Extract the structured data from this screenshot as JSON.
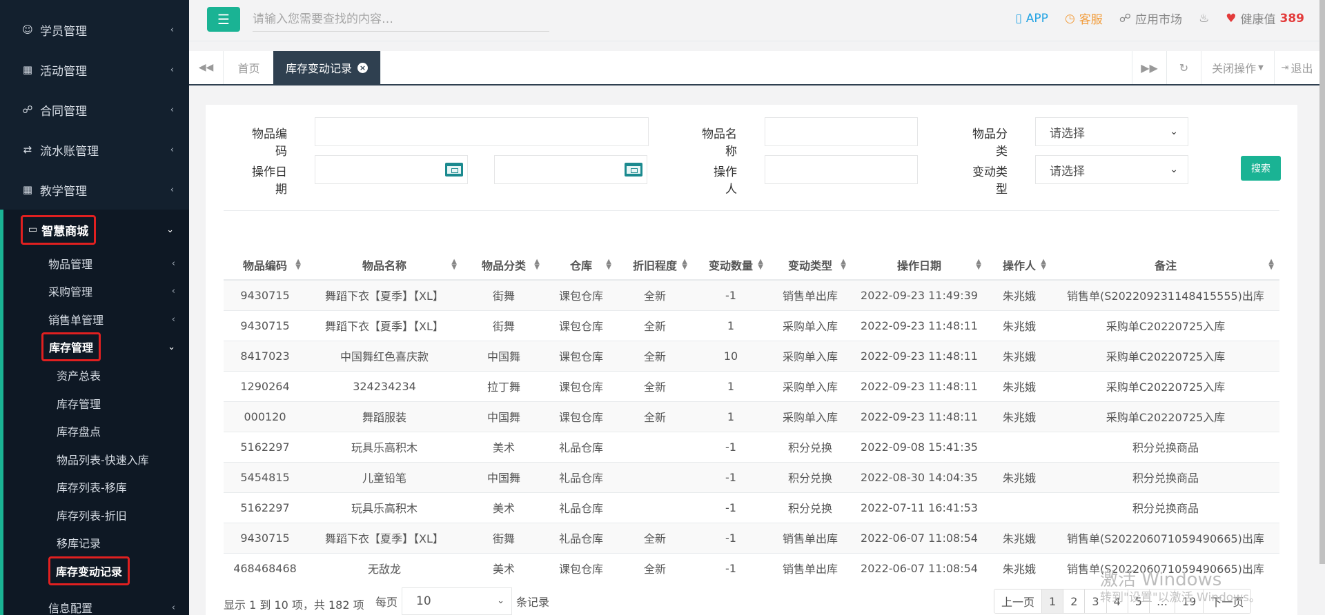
{
  "sidebar": {
    "top_items": [
      {
        "label": "学员管理",
        "icon": "users-icon"
      },
      {
        "label": "活动管理",
        "icon": "map-icon"
      },
      {
        "label": "合同管理",
        "icon": "cart-icon"
      },
      {
        "label": "流水账管理",
        "icon": "retweet-icon"
      },
      {
        "label": "教学管理",
        "icon": "calendar-icon"
      },
      {
        "label": "智慧商城",
        "icon": "inbox-icon"
      }
    ],
    "sub_items": [
      {
        "label": "物品管理"
      },
      {
        "label": "采购管理"
      },
      {
        "label": "销售单管理"
      },
      {
        "label": "库存管理"
      }
    ],
    "sub3_items": [
      {
        "label": "资产总表"
      },
      {
        "label": "库存管理"
      },
      {
        "label": "库存盘点"
      },
      {
        "label": "物品列表-快速入库"
      },
      {
        "label": "库存列表-移库"
      },
      {
        "label": "库存列表-折旧"
      },
      {
        "label": "移库记录"
      },
      {
        "label": "库存变动记录"
      }
    ],
    "bottom_item": {
      "label": "信息配置"
    }
  },
  "topbar": {
    "search_placeholder": "请输入您需要查找的内容…",
    "app_label": "APP",
    "kefu_label": "客服",
    "market_label": "应用市场",
    "health_label": "健康值",
    "health_value": "389"
  },
  "tabs": {
    "home": "首页",
    "active": "库存变动记录",
    "close_ops": "关闭操作",
    "logout": "退出"
  },
  "filters": {
    "item_code_label": "物品编码",
    "item_name_label": "物品名称",
    "item_category_label": "物品分类",
    "item_category_value": "请选择",
    "op_date_label": "操作日期",
    "operator_label": "操作人",
    "change_type_label": "变动类型",
    "change_type_value": "请选择",
    "search_button": "搜索"
  },
  "table": {
    "headers": [
      "物品编码",
      "物品名称",
      "物品分类",
      "仓库",
      "折旧程度",
      "变动数量",
      "变动类型",
      "操作日期",
      "操作人",
      "备注"
    ],
    "rows": [
      [
        "9430715",
        "舞蹈下衣【夏季】【XL】",
        "街舞",
        "课包仓库",
        "全新",
        "-1",
        "销售单出库",
        "2022-09-23 11:49:39",
        "朱兆娥",
        "销售单(S202209231148415555)出库"
      ],
      [
        "9430715",
        "舞蹈下衣【夏季】【XL】",
        "街舞",
        "课包仓库",
        "全新",
        "1",
        "采购单入库",
        "2022-09-23 11:48:11",
        "朱兆娥",
        "采购单C20220725入库"
      ],
      [
        "8417023",
        "中国舞红色喜庆款",
        "中国舞",
        "课包仓库",
        "全新",
        "10",
        "采购单入库",
        "2022-09-23 11:48:11",
        "朱兆娥",
        "采购单C20220725入库"
      ],
      [
        "1290264",
        "324234234",
        "拉丁舞",
        "课包仓库",
        "全新",
        "1",
        "采购单入库",
        "2022-09-23 11:48:11",
        "朱兆娥",
        "采购单C20220725入库"
      ],
      [
        "000120",
        "舞蹈服装",
        "中国舞",
        "课包仓库",
        "全新",
        "1",
        "采购单入库",
        "2022-09-23 11:48:11",
        "朱兆娥",
        "采购单C20220725入库"
      ],
      [
        "5162297",
        "玩具乐高积木",
        "美术",
        "礼品仓库",
        "",
        "-1",
        "积分兑换",
        "2022-09-08 15:41:35",
        "",
        "积分兑换商品"
      ],
      [
        "5454815",
        "儿童铅笔",
        "中国舞",
        "礼品仓库",
        "",
        "-1",
        "积分兑换",
        "2022-08-30 14:04:35",
        "朱兆娥",
        "积分兑换商品"
      ],
      [
        "5162297",
        "玩具乐高积木",
        "美术",
        "礼品仓库",
        "",
        "-1",
        "积分兑换",
        "2022-07-11 16:41:53",
        "",
        "积分兑换商品"
      ],
      [
        "9430715",
        "舞蹈下衣【夏季】【XL】",
        "街舞",
        "礼品仓库",
        "全新",
        "-1",
        "销售单出库",
        "2022-06-07 11:08:54",
        "朱兆娥",
        "销售单(S202206071059490665)出库"
      ],
      [
        "468468468",
        "无敌龙",
        "美术",
        "课包仓库",
        "全新",
        "-1",
        "销售单出库",
        "2022-06-07 11:08:54",
        "朱兆娥",
        "销售单(S202206071059490665)出库"
      ]
    ]
  },
  "footer": {
    "info": "显示 1 到 10 项，共 182 项",
    "per_page_prefix": "每页",
    "per_page_value": "10",
    "per_page_suffix": "条记录",
    "pages": [
      "上一页",
      "1",
      "2",
      "3",
      "4",
      "5",
      "…",
      "19",
      "下一页"
    ]
  },
  "watermark": {
    "line1": "激活 Windows",
    "line2": "转到\"设置\"以激活 Windows。"
  },
  "colors": {
    "accent": "#1ab394",
    "sidebar_bg": "#13202e",
    "highlight_red": "#e02020"
  }
}
